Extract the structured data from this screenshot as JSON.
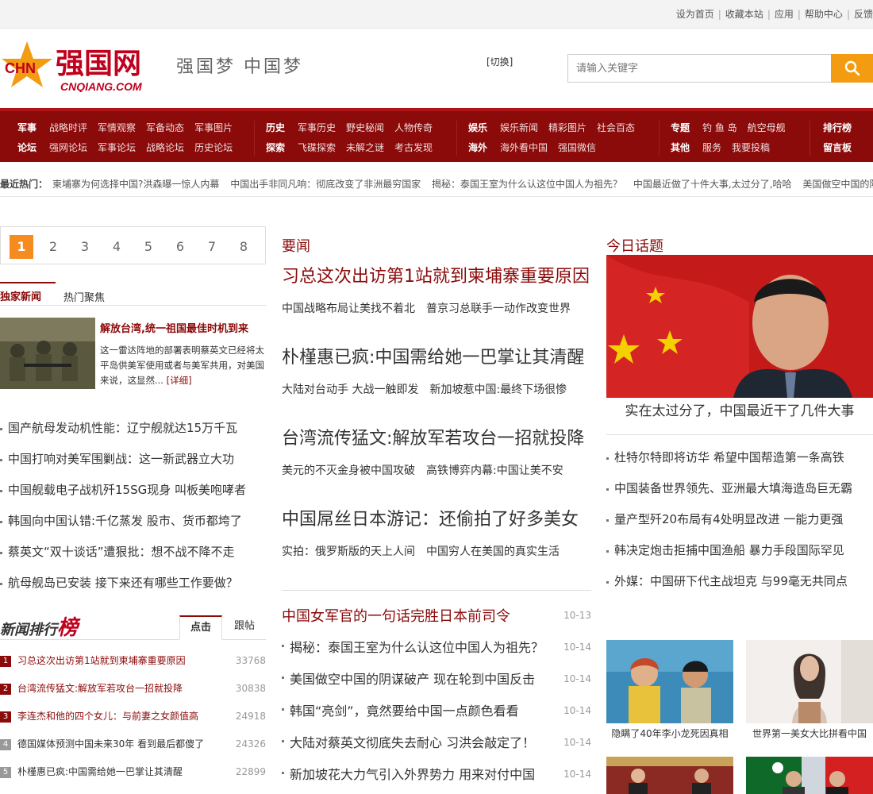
{
  "topbar": {
    "links": [
      "设为首页",
      "收藏本站",
      "应用",
      "帮助中心",
      "反馈"
    ]
  },
  "header": {
    "logo_badge": "CHN",
    "logo_text": "强国网",
    "logo_domain": "CNQIANG.COM",
    "slogan": "强国梦 中国梦",
    "switch_label": "[切换]",
    "search_placeholder": "请输入关键字",
    "search_icon": "search-icon",
    "accent_color": "#f39c12"
  },
  "nav": {
    "groups": [
      {
        "row1": {
          "cat": "军事",
          "items": [
            "战略时评",
            "军情观察",
            "军备动态",
            "军事图片"
          ]
        },
        "row2": {
          "cat": "论坛",
          "items": [
            "强网论坛",
            "军事论坛",
            "战略论坛",
            "历史论坛"
          ]
        }
      },
      {
        "row1": {
          "cat": "历史",
          "items": [
            "军事历史",
            "野史秘闻",
            "人物传奇"
          ]
        },
        "row2": {
          "cat": "探索",
          "items": [
            "飞碟探索",
            "未解之谜",
            "考古发现"
          ]
        }
      },
      {
        "row1": {
          "cat": "娱乐",
          "items": [
            "娱乐新闻",
            "精彩图片",
            "社会百态"
          ]
        },
        "row2": {
          "cat": "海外",
          "items": [
            "海外看中国",
            "强国微信"
          ]
        }
      },
      {
        "row1": {
          "cat": "专题",
          "items": [
            "钓 鱼 岛",
            "航空母舰"
          ]
        },
        "row2": {
          "cat": "其他",
          "items": [
            "服务",
            "我要投稿"
          ]
        }
      },
      {
        "row1": {
          "cat": "排行榜",
          "items": []
        },
        "row2": {
          "cat": "留言板",
          "items": []
        }
      }
    ],
    "bg_color": "#8b0a0a"
  },
  "hot": {
    "label": "最近热门：",
    "items": [
      "柬埔寨为何选择中国?洪森曝一惊人内幕",
      "中国出手非同凡响：彻底改变了非洲最穷国家",
      "揭秘：泰国王室为什么认这位中国人为祖先？",
      "中国最近做了十件大事,太过分了,哈哈",
      "美国做空中国的阴"
    ]
  },
  "pager": {
    "pages": [
      "1",
      "2",
      "3",
      "4",
      "5",
      "6",
      "7",
      "8"
    ],
    "active": "1"
  },
  "left_tabs": [
    "独家新闻",
    "热门聚焦"
  ],
  "feature": {
    "title": "解放台湾,统一祖国最佳时机到来",
    "desc": "这一雷达阵地的部署表明蔡英文已经将太平岛供美军使用或者与美军共用，对美国来说，这显然...",
    "more": "[详细]"
  },
  "left_list": [
    "国产航母发动机性能：辽宁舰就达15万千瓦",
    "中国打响对美军围剿战：这一新武器立大功",
    "中国舰载电子战机歼15SG现身 叫板美咆哮者",
    "韩国向中国认错:千亿蒸发 股市、货币都垮了",
    "蔡英文“双十谈话”遭狠批：想不战不降不走",
    "航母舰岛已安装 接下来还有哪些工作要做？"
  ],
  "ranking": {
    "title_a": "新闻排行",
    "title_b": "榜",
    "tabs": [
      "点击",
      "跟帖"
    ],
    "items": [
      {
        "n": "1",
        "text": "习总这次出访第1站就到柬埔寨重要原因",
        "count": "33768"
      },
      {
        "n": "2",
        "text": "台湾流传猛文:解放军若攻台一招就投降",
        "count": "30838"
      },
      {
        "n": "3",
        "text": "李连杰和他的四个女儿：与前妻之女颜值高",
        "count": "24918"
      },
      {
        "n": "4",
        "text": "德国媒体预测中国未来30年 看到最后都傻了",
        "count": "24326"
      },
      {
        "n": "5",
        "text": "朴槿惠已疯:中国需给她一巴掌让其清醒",
        "count": "22899"
      }
    ]
  },
  "middle": {
    "section": "要闻",
    "stories": [
      {
        "headline": "习总这次出访第1站就到柬埔寨重要原因",
        "subs": [
          "中国战略布局让美找不着北",
          "普京习总联手一动作改变世界"
        ]
      },
      {
        "headline": "朴槿惠已疯:中国需给她一巴掌让其清醒",
        "subs": [
          "大陆对台动手 大战一触即发",
          "新加坡惹中国:最终下场很惨"
        ]
      },
      {
        "headline": "台湾流传猛文:解放军若攻台一招就投降",
        "subs": [
          "美元的不灭金身被中国攻破",
          "高铁博弈内幕:中国让美不安"
        ]
      },
      {
        "headline": "中国屌丝日本游记：还偷拍了好多美女",
        "subs": [
          "实拍：俄罗斯版的天上人间",
          "中国穷人在美国的真实生活"
        ]
      }
    ],
    "list": [
      {
        "text": "中国女军官的一句话完胜日本前司令",
        "date": "10-13"
      },
      {
        "text": "揭秘：泰国王室为什么认这位中国人为祖先？",
        "date": "10-14"
      },
      {
        "text": "美国做空中国的阴谋破产 现在轮到中国反击",
        "date": "10-14"
      },
      {
        "text": "韩国“亮剑”，竟然要给中国一点颜色看看",
        "date": "10-14"
      },
      {
        "text": "大陆对蔡英文彻底失去耐心 习洪会敲定了！",
        "date": "10-14"
      },
      {
        "text": "新加坡花大力气引入外界势力 用来对付中国",
        "date": "10-14"
      }
    ]
  },
  "right": {
    "section": "今日话题",
    "caption": "实在太过分了，中国最近干了几件大事",
    "list": [
      "杜特尔特即将访华 希望中国帮造第一条高铁",
      "中国装备世界领先、亚洲最大填海造岛巨无霸",
      "量产型歼20布局有4处明显改进 一能力更强",
      "韩决定炮击拒捕中国渔船 暴力手段国际罕见",
      "外媒：中国研下代主战坦克 与99毫无共同点"
    ],
    "thumbs": [
      {
        "caption": "隐瞒了40年李小龙死因真相"
      },
      {
        "caption": "世界第一美女大比拼看中国"
      }
    ]
  }
}
